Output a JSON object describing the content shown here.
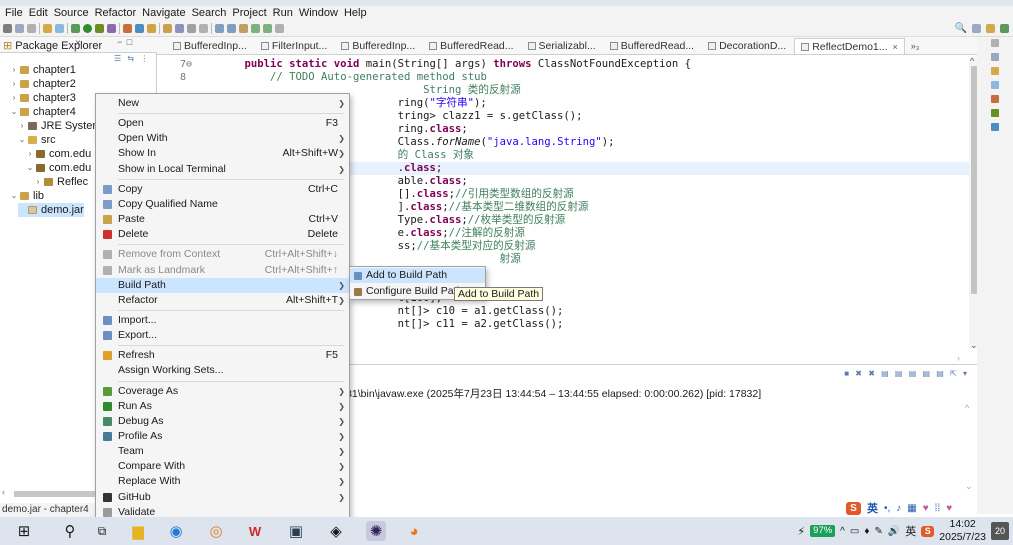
{
  "menubar": [
    "File",
    "Edit",
    "Source",
    "Refactor",
    "Navigate",
    "Search",
    "Project",
    "Run",
    "Window",
    "Help"
  ],
  "package_explorer": {
    "title": "Package Explorer",
    "close": "×",
    "controls": "− □",
    "tree": [
      {
        "arrow": "›",
        "icon": "proj",
        "label": "chapter1"
      },
      {
        "arrow": "›",
        "icon": "proj",
        "label": "chapter2"
      },
      {
        "arrow": "›",
        "icon": "proj",
        "label": "chapter3"
      },
      {
        "arrow": "⌄",
        "icon": "proj",
        "label": "chapter4"
      },
      {
        "arrow": "›",
        "icon": "jre",
        "label": "JRE System"
      },
      {
        "arrow": "⌄",
        "icon": "src",
        "label": "src"
      },
      {
        "arrow": "›",
        "icon": "pkgi",
        "label": "com.edu"
      },
      {
        "arrow": "⌄",
        "icon": "pkgi",
        "label": "com.edu"
      },
      {
        "arrow": "›",
        "icon": "java",
        "label": "Reflec"
      },
      {
        "arrow": "⌄",
        "icon": "lib",
        "label": "lib"
      },
      {
        "arrow": "",
        "icon": "jar",
        "label": "demo.jar"
      }
    ]
  },
  "status_bar": {
    "left": "demo.jar - chapter4"
  },
  "editor": {
    "tabs": [
      {
        "label": "BufferedInp...",
        "active": false
      },
      {
        "label": "FilterInput...",
        "active": false
      },
      {
        "label": "BufferedInp...",
        "active": false
      },
      {
        "label": "BufferedRead...",
        "active": false
      },
      {
        "label": "Serializabl...",
        "active": false
      },
      {
        "label": "BufferedRead...",
        "active": false
      },
      {
        "label": "DecorationD...",
        "active": false
      },
      {
        "label": "ReflectDemo1...",
        "active": true
      }
    ],
    "tab_more": "»₃",
    "lines": [
      {
        "num": "7⊖",
        "html": "    <span class='kw'>public static void</span> main(String[] args) <span class='kw'>throws</span> ClassNotFoundException {"
      },
      {
        "num": "8",
        "html": "        <span class='cm'>// TODO Auto-generated method stub</span>"
      },
      {
        "num": "",
        "html": "                                <span class='cm'>String 类的反射源</span>"
      },
      {
        "num": "",
        "html": "                            ring(<span class='str'>\"字符串\"</span>);"
      },
      {
        "num": "",
        "html": "                            tring> clazz1 = s.getClass();"
      },
      {
        "num": "",
        "html": "                            ring.<span class='kw'>class</span>;"
      },
      {
        "num": "",
        "html": "                            Class.<span class='it'>forName</span>(<span class='str'>\"java.lang.String\"</span>);"
      },
      {
        "num": "",
        "html": "                            <span class='cm'>的 Class 对象</span>"
      },
      {
        "num": "",
        "html": "                            .<span class='kw'>class</span>;",
        "hl": true
      },
      {
        "num": "",
        "html": "                            able.<span class='kw'>class</span>;"
      },
      {
        "num": "",
        "html": "                            [].<span class='kw'>class</span>;<span class='cm'>//引用类型数组的反射源</span>"
      },
      {
        "num": "",
        "html": "                            ].<span class='kw'>class</span>;<span class='cm'>//基本类型二维数组的反射源</span>"
      },
      {
        "num": "",
        "html": "                            Type.<span class='kw'>class</span>;<span class='cm'>//枚举类型的反射源</span>"
      },
      {
        "num": "",
        "html": "                            e.<span class='kw'>class</span>;<span class='cm'>//注解的反射源</span>"
      },
      {
        "num": "",
        "html": "                            ss;<span class='cm'>//基本类型对应的反射源</span>"
      },
      {
        "num": "",
        "html": "                                            <span class='cm'>射源</span>"
      },
      {
        "num": "",
        "html": ""
      },
      {
        "num": "",
        "html": "                            t[10];"
      },
      {
        "num": "",
        "html": "                            t[100];"
      },
      {
        "num": "",
        "html": "                            nt[]> c10 = a1.getClass();"
      },
      {
        "num": "",
        "html": "                            nt[]> c11 = a2.getClass();"
      }
    ]
  },
  "console": {
    "line": "cation] C:\\Program Files\\Java\\jdk1.8.0_131\\bin\\javaw.exe  (2025年7月23日 13:44:54 – 13:44:55 elapsed: 0:00:00.262) [pid: 17832]"
  },
  "context_menu": {
    "items": [
      {
        "label": "New",
        "shortcut": "",
        "submenu": true,
        "icon": "",
        "disabled": false
      },
      {
        "sep": true
      },
      {
        "label": "Open",
        "shortcut": "F3",
        "submenu": false,
        "icon": "",
        "disabled": false
      },
      {
        "label": "Open With",
        "shortcut": "",
        "submenu": true,
        "icon": "",
        "disabled": false
      },
      {
        "label": "Show In",
        "shortcut": "Alt+Shift+W",
        "submenu": true,
        "icon": "",
        "disabled": false
      },
      {
        "label": "Show in Local Terminal",
        "shortcut": "",
        "submenu": true,
        "icon": "",
        "disabled": false
      },
      {
        "sep": true
      },
      {
        "label": "Copy",
        "shortcut": "Ctrl+C",
        "submenu": false,
        "icon": "copy-icon",
        "disabled": false
      },
      {
        "label": "Copy Qualified Name",
        "shortcut": "",
        "submenu": false,
        "icon": "copy-qualified-icon",
        "disabled": false
      },
      {
        "label": "Paste",
        "shortcut": "Ctrl+V",
        "submenu": false,
        "icon": "paste-icon",
        "disabled": false
      },
      {
        "label": "Delete",
        "shortcut": "Delete",
        "submenu": false,
        "icon": "delete-icon",
        "disabled": false
      },
      {
        "sep": true
      },
      {
        "label": "Remove from Context",
        "shortcut": "Ctrl+Alt+Shift+↓",
        "submenu": false,
        "icon": "remove-context-icon",
        "disabled": true
      },
      {
        "label": "Mark as Landmark",
        "shortcut": "Ctrl+Alt+Shift+↑",
        "submenu": false,
        "icon": "landmark-icon",
        "disabled": true
      },
      {
        "label": "Build Path",
        "shortcut": "",
        "submenu": true,
        "icon": "",
        "disabled": false,
        "hover": true
      },
      {
        "label": "Refactor",
        "shortcut": "Alt+Shift+T",
        "submenu": true,
        "icon": "",
        "disabled": false
      },
      {
        "sep": true
      },
      {
        "label": "Import...",
        "shortcut": "",
        "submenu": false,
        "icon": "import-icon",
        "disabled": false
      },
      {
        "label": "Export...",
        "shortcut": "",
        "submenu": false,
        "icon": "export-icon",
        "disabled": false
      },
      {
        "sep": true
      },
      {
        "label": "Refresh",
        "shortcut": "F5",
        "submenu": false,
        "icon": "refresh-icon",
        "disabled": false
      },
      {
        "label": "Assign Working Sets...",
        "shortcut": "",
        "submenu": false,
        "icon": "",
        "disabled": false
      },
      {
        "sep": true
      },
      {
        "label": "Coverage As",
        "shortcut": "",
        "submenu": true,
        "icon": "coverage-icon",
        "disabled": false
      },
      {
        "label": "Run As",
        "shortcut": "",
        "submenu": true,
        "icon": "run-icon",
        "disabled": false
      },
      {
        "label": "Debug As",
        "shortcut": "",
        "submenu": true,
        "icon": "debug-icon",
        "disabled": false
      },
      {
        "label": "Profile As",
        "shortcut": "",
        "submenu": true,
        "icon": "profile-icon",
        "disabled": false
      },
      {
        "label": "Team",
        "shortcut": "",
        "submenu": true,
        "icon": "",
        "disabled": false
      },
      {
        "label": "Compare With",
        "shortcut": "",
        "submenu": true,
        "icon": "",
        "disabled": false
      },
      {
        "label": "Replace With",
        "shortcut": "",
        "submenu": true,
        "icon": "",
        "disabled": false
      },
      {
        "label": "GitHub",
        "shortcut": "",
        "submenu": true,
        "icon": "github-icon",
        "disabled": false
      },
      {
        "label": "Validate",
        "shortcut": "",
        "submenu": false,
        "icon": "validate-icon",
        "disabled": false
      },
      {
        "sep": true
      },
      {
        "label": "Properties",
        "shortcut": "Alt+Enter",
        "submenu": false,
        "icon": "",
        "disabled": false
      }
    ]
  },
  "build_path_submenu": {
    "items": [
      {
        "label": "Add to Build Path",
        "icon": "add-build-path-icon",
        "hover": true
      },
      {
        "label": "Configure Build Path",
        "icon": "configure-build-path-icon",
        "hover": false
      }
    ]
  },
  "tooltip": "Add to Build Path",
  "ime": {
    "logo": "S",
    "mode": "英"
  },
  "taskbar": {
    "battery": "97%",
    "lang": "英",
    "time": "14:02",
    "date": "2025/7/23",
    "notifications": "20"
  },
  "colors": {
    "accent": "#cce5ff",
    "keyword": "#7f0055",
    "comment": "#3f7f5f",
    "string": "#2a00ff",
    "battery": "#1aa05a"
  }
}
